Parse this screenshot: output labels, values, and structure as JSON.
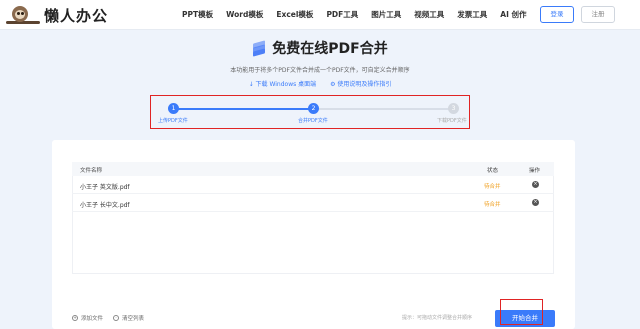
{
  "header": {
    "brand": "懒人办公",
    "nav": [
      "PPT模板",
      "Word模板",
      "Excel模板",
      "PDF工具",
      "图片工具",
      "视频工具",
      "发票工具",
      "AI 创作"
    ],
    "login_label": "登录",
    "register_label": "注册"
  },
  "page": {
    "title": "免费在线PDF合并",
    "subtitle": "本功能用于将多个PDF文件合并成一个PDF文件，可自定义合并顺序",
    "link_download": "↓ 下载 Windows 桌面端",
    "link_help": "⚙ 使用说明及操作指引"
  },
  "stepper": {
    "steps": [
      {
        "num": "1",
        "label": "上传PDF文件",
        "state": "done"
      },
      {
        "num": "2",
        "label": "合并PDF文件",
        "state": "active"
      },
      {
        "num": "3",
        "label": "下载PDF文件",
        "state": "pending"
      }
    ]
  },
  "table": {
    "columns": [
      "文件名称",
      "状态",
      "操作"
    ],
    "rows": [
      {
        "name": "小王子 英文版.pdf",
        "status": "待合并"
      },
      {
        "name": "小王子 长中文.pdf",
        "status": "待合并"
      }
    ]
  },
  "footer": {
    "add_file": "添加文件",
    "clear_list": "清空列表",
    "hint": "提示：可拖动文件调整合并顺序",
    "start_label": "开始合并"
  },
  "colors": {
    "accent": "#3a7bfa",
    "status_pending": "#f0a020",
    "highlight": "#e02424"
  }
}
